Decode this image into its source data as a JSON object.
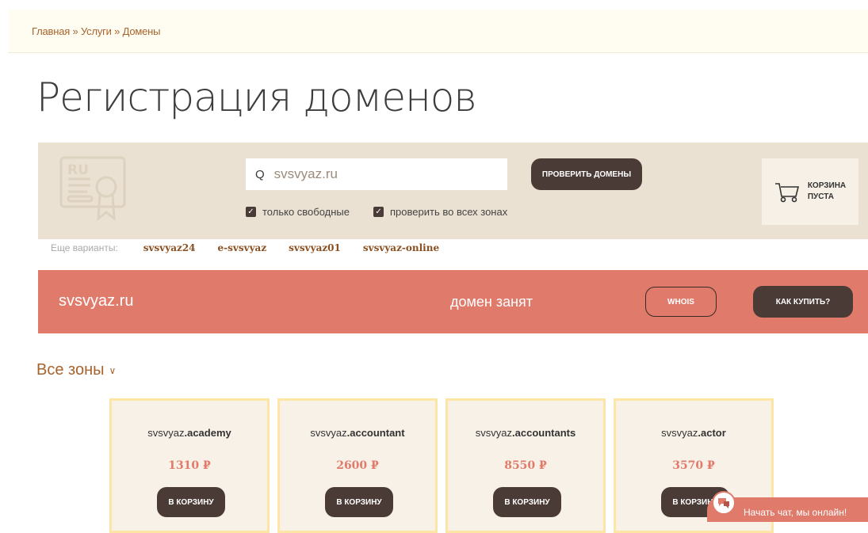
{
  "breadcrumb": {
    "items": [
      "Главная",
      "Услуги",
      "Домены"
    ],
    "separator": "»"
  },
  "page": {
    "title": "Регистрация доменов"
  },
  "search": {
    "value": "svsvyaz.ru",
    "button": "ПРОВЕРИТЬ ДОМЕНЫ",
    "options": [
      {
        "label": "только свободные",
        "checked": true
      },
      {
        "label": "проверить во всех зонах",
        "checked": true
      }
    ]
  },
  "cart": {
    "line1": "КОРЗИНА",
    "line2": "ПУСТА"
  },
  "variants": {
    "label": "Еще варианты:",
    "items": [
      "svsvyaz24",
      "e-svsvyaz",
      "svsvyaz01",
      "svsvyaz-online"
    ]
  },
  "result": {
    "domain": "svsvyaz.ru",
    "status": "домен занят",
    "whois": "WHOIS",
    "how_to_buy": "КАК КУПИТЬ?"
  },
  "zones": {
    "title": "Все зоны",
    "cards": [
      {
        "base": "svsvyaz",
        "zone": ".academy",
        "price": "1310 ₽",
        "button": "В КОРЗИНУ"
      },
      {
        "base": "svsvyaz",
        "zone": ".accountant",
        "price": "2600 ₽",
        "button": "В КОРЗИНУ"
      },
      {
        "base": "svsvyaz",
        "zone": ".accountants",
        "price": "8550 ₽",
        "button": "В КОРЗИНУ"
      },
      {
        "base": "svsvyaz",
        "zone": ".actor",
        "price": "3570 ₽",
        "button": "В КОРЗИНУ"
      }
    ]
  },
  "chat": {
    "label": "Начать чат, мы онлайн!"
  },
  "colors": {
    "accent": "#e07b6c",
    "dark": "#4b3b36",
    "panel": "#ebe1d2",
    "link": "#a7632c"
  }
}
